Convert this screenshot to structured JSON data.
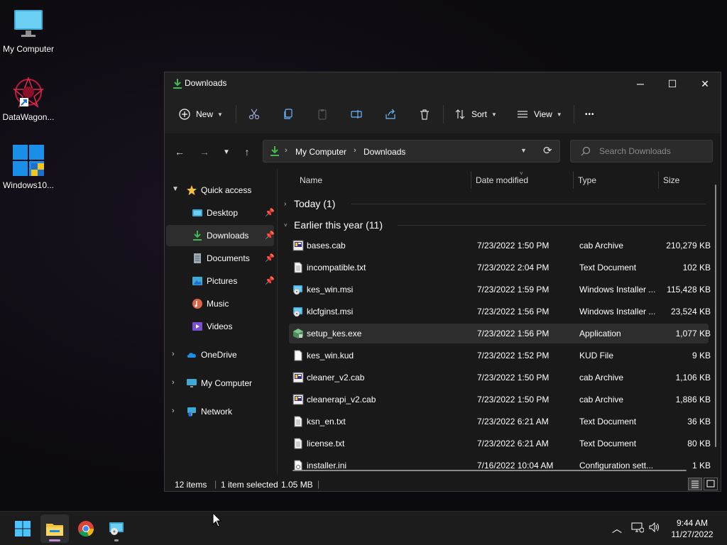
{
  "desktop": {
    "icons": [
      {
        "label": "My Computer",
        "icon": "monitor-icon"
      },
      {
        "label": "DataWagon...",
        "icon": "datawagon-icon"
      },
      {
        "label": "Windows10...",
        "icon": "windows-logo-icon"
      }
    ]
  },
  "window": {
    "title": "Downloads",
    "controls": {
      "minimize": "─",
      "maximize": "☐",
      "close": "✕"
    }
  },
  "toolbar": {
    "new_label": "New",
    "sort_label": "Sort",
    "view_label": "View",
    "more_label": "•••"
  },
  "address": {
    "crumbs": [
      "My Computer",
      "Downloads"
    ],
    "separator": "›"
  },
  "search": {
    "placeholder": "Search Downloads"
  },
  "nav": {
    "quick_access": "Quick access",
    "pinned": [
      "Desktop",
      "Downloads",
      "Documents",
      "Pictures"
    ],
    "unpinned": [
      "Music",
      "Videos"
    ],
    "roots": [
      "OneDrive",
      "My Computer",
      "Network"
    ]
  },
  "columns": {
    "name": "Name",
    "date": "Date modified",
    "type": "Type",
    "size": "Size"
  },
  "groups": [
    {
      "label": "Today (1)"
    },
    {
      "label": "Earlier this year (11)"
    }
  ],
  "files": [
    {
      "name": "bases.cab",
      "date": "7/23/2022 1:50 PM",
      "type": "cab Archive",
      "size": "210,279 KB",
      "icon": "cab-icon"
    },
    {
      "name": "incompatible.txt",
      "date": "7/23/2022 2:04 PM",
      "type": "Text Document",
      "size": "102 KB",
      "icon": "text-file-icon"
    },
    {
      "name": "kes_win.msi",
      "date": "7/23/2022 1:59 PM",
      "type": "Windows Installer ...",
      "size": "115,428 KB",
      "icon": "msi-icon"
    },
    {
      "name": "klcfginst.msi",
      "date": "7/23/2022 1:56 PM",
      "type": "Windows Installer ...",
      "size": "23,524 KB",
      "icon": "msi-icon"
    },
    {
      "name": "setup_kes.exe",
      "date": "7/23/2022 1:56 PM",
      "type": "Application",
      "size": "1,077 KB",
      "icon": "exe-icon"
    },
    {
      "name": "kes_win.kud",
      "date": "7/23/2022 1:52 PM",
      "type": "KUD File",
      "size": "9 KB",
      "icon": "blank-file-icon"
    },
    {
      "name": "cleaner_v2.cab",
      "date": "7/23/2022 1:50 PM",
      "type": "cab Archive",
      "size": "1,106 KB",
      "icon": "cab-icon"
    },
    {
      "name": "cleanerapi_v2.cab",
      "date": "7/23/2022 1:50 PM",
      "type": "cab Archive",
      "size": "1,886 KB",
      "icon": "cab-icon"
    },
    {
      "name": "ksn_en.txt",
      "date": "7/23/2022 6:21 AM",
      "type": "Text Document",
      "size": "36 KB",
      "icon": "text-file-icon"
    },
    {
      "name": "license.txt",
      "date": "7/23/2022 6:21 AM",
      "type": "Text Document",
      "size": "80 KB",
      "icon": "text-file-icon"
    },
    {
      "name": "installer.ini",
      "date": "7/16/2022 10:04 AM",
      "type": "Configuration sett...",
      "size": "1 KB",
      "icon": "ini-file-icon"
    }
  ],
  "selected_file": "setup_kes.exe",
  "status": {
    "items": "12 items",
    "selected": "1 item selected",
    "size": "1.05 MB"
  },
  "taskbar": {
    "apps": [
      "start-icon",
      "file-explorer-icon",
      "chrome-icon",
      "installer-app-icon"
    ],
    "time": "9:44 AM",
    "date": "11/27/2022"
  },
  "colors": {
    "accent": "#4cc2ff",
    "folder": "#f4c33a",
    "download_green": "#3fb950",
    "selection": "#2d2d2d"
  }
}
